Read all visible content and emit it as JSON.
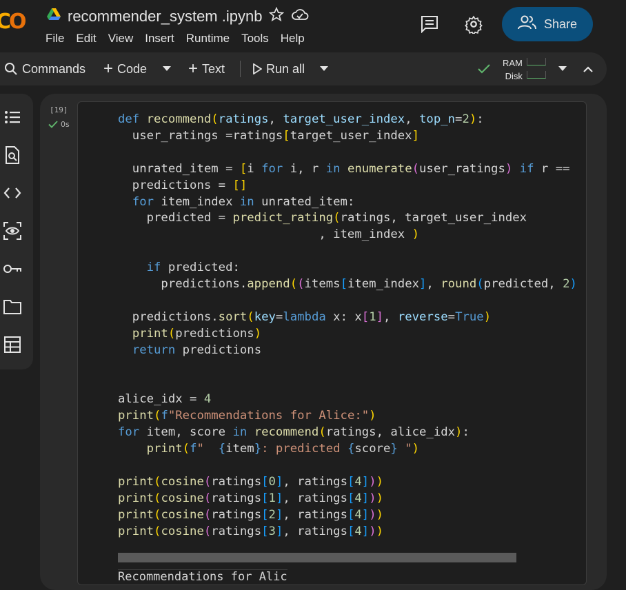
{
  "header": {
    "notebook_name": "recommender_system .ipynb",
    "menu": [
      "File",
      "Edit",
      "View",
      "Insert",
      "Runtime",
      "Tools",
      "Help"
    ],
    "share_label": "Share",
    "icons": [
      "drive-icon",
      "star-icon",
      "cloud-icon",
      "comment-icon",
      "gear-icon",
      "people-icon"
    ]
  },
  "toolbar": {
    "commands_label": "Commands",
    "code_label": "Code",
    "text_label": "Text",
    "run_all_label": "Run all",
    "ram_label": "RAM",
    "disk_label": "Disk"
  },
  "sidebar": {
    "items": [
      "toc-icon",
      "find-icon",
      "code-snippets-icon",
      "variables-icon",
      "secrets-icon",
      "files-icon",
      "data-table-icon"
    ]
  },
  "cell": {
    "execution_count": "[19]",
    "exec_time": "0s",
    "output_preview": "Recommendations for Alic"
  },
  "colors": {
    "background": "#1f1f1f",
    "panel": "#2a2a2a",
    "share_button": "#0b4f7c",
    "success_green": "#5fb36b"
  }
}
